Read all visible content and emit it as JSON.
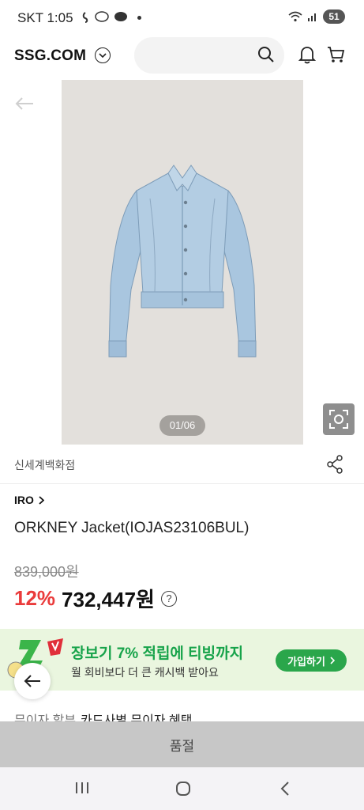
{
  "status_bar": {
    "time": "SKT 1:05",
    "battery": "51"
  },
  "header": {
    "logo": "SSG.COM",
    "search_placeholder": ""
  },
  "gallery": {
    "counter": "01/06"
  },
  "product": {
    "store": "신세계백화점",
    "brand": "IRO",
    "name": "ORKNEY Jacket(IOJAS23106BUL)",
    "original_price": "839,000원",
    "discount": "12%",
    "price": "732,447원",
    "help_symbol": "?"
  },
  "promo": {
    "title": "장보기 7% 적립에 티빙까지",
    "subtitle": "월 회비보다 더 큰 캐시백 받아요",
    "button": "가입하기"
  },
  "installment": {
    "label": "무이자 할부",
    "value": "카드사별 무이자 혜택"
  },
  "bottom": {
    "soldout_label": "품절"
  },
  "colors": {
    "discount": "#ea3b3b",
    "promo_green": "#17a34a",
    "promo_bg": "#eaf6df",
    "soldout_bg": "#c7c7c7"
  }
}
